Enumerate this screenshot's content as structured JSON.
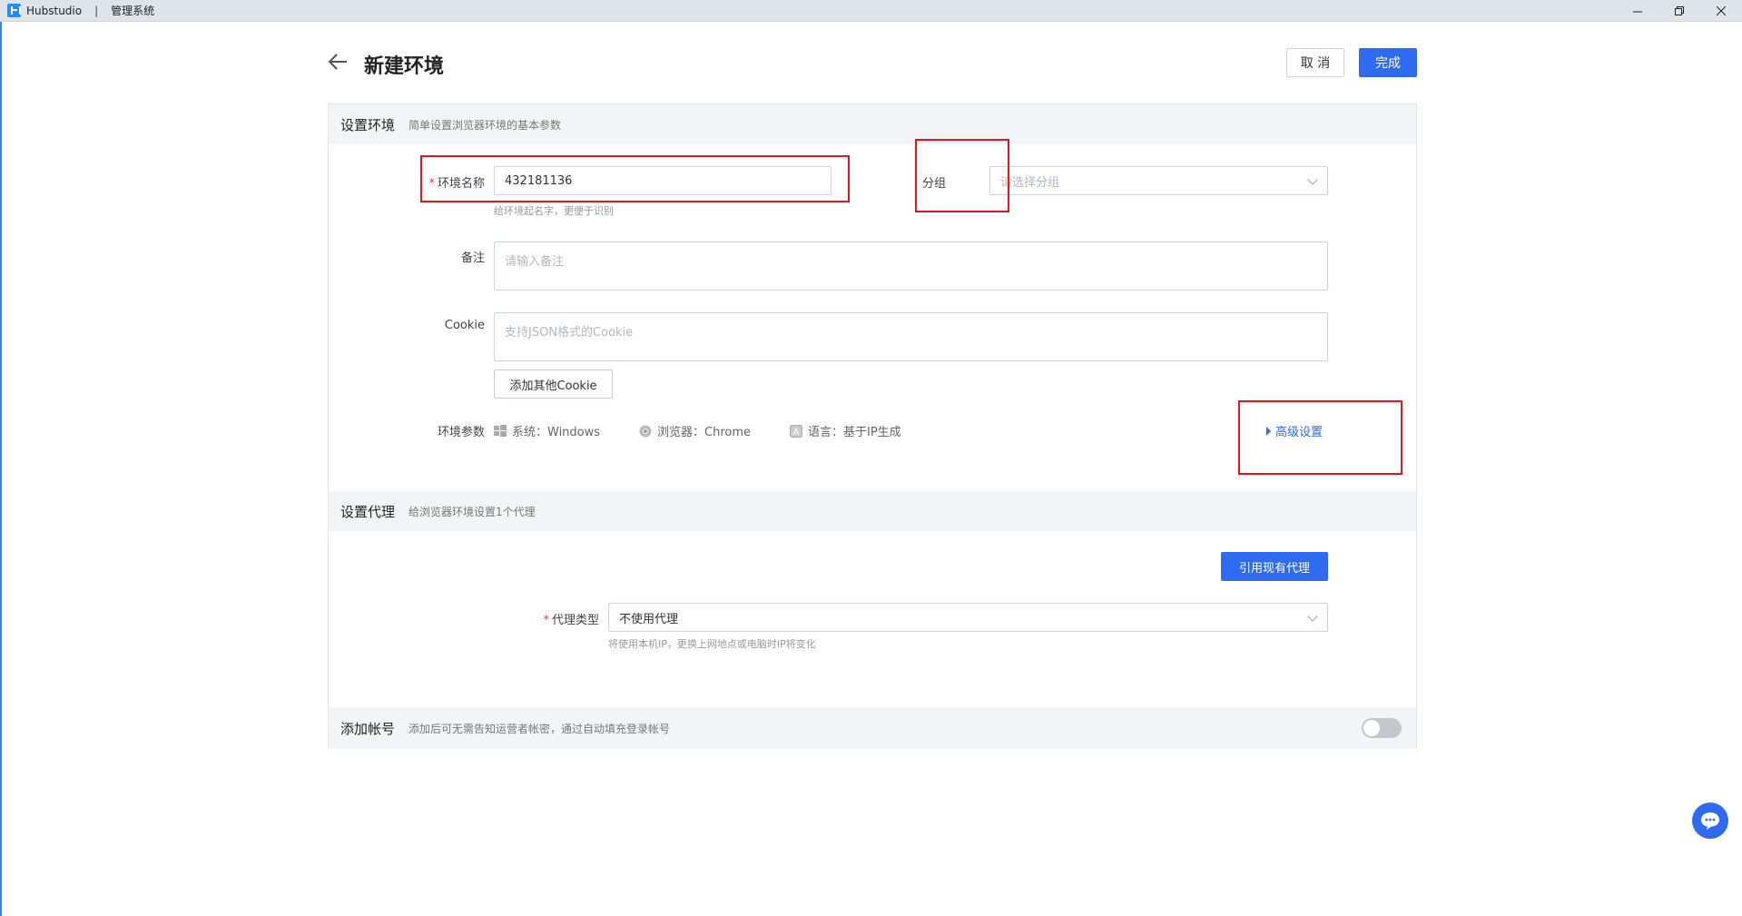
{
  "titlebar": {
    "app_name": "Hubstudio",
    "separator": "|",
    "section": "管理系统"
  },
  "header": {
    "title": "新建环境",
    "cancel_label": "取 消",
    "done_label": "完成"
  },
  "env_section": {
    "title": "设置环境",
    "desc": "简单设置浏览器环境的基本参数",
    "name_label": "环境名称",
    "name_value": "432181136",
    "name_hint": "给环境起名字，更便于识别",
    "group_label": "分组",
    "group_placeholder": "请选择分组",
    "remark_label": "备注",
    "remark_placeholder": "请输入备注",
    "cookie_label": "Cookie",
    "cookie_placeholder": "支持JSON格式的Cookie",
    "add_cookie_label": "添加其他Cookie",
    "params_label": "环境参数",
    "param_system": "系统：Windows",
    "param_browser": "浏览器：Chrome",
    "param_language": "语言：基于IP生成",
    "advanced_label": "高级设置"
  },
  "proxy_section": {
    "title": "设置代理",
    "desc": "给浏览器环境设置1个代理",
    "use_existing_label": "引用现有代理",
    "type_label": "代理类型",
    "type_value": "不使用代理",
    "type_hint": "将使用本机IP，更换上网地点或电脑时IP将变化"
  },
  "account_section": {
    "title": "添加帐号",
    "desc": "添加后可无需告知运营者帐密，通过自动填充登录帐号",
    "toggle_on": false
  },
  "colors": {
    "accent": "#2e6bf0",
    "highlight_box": "#e8141b"
  }
}
